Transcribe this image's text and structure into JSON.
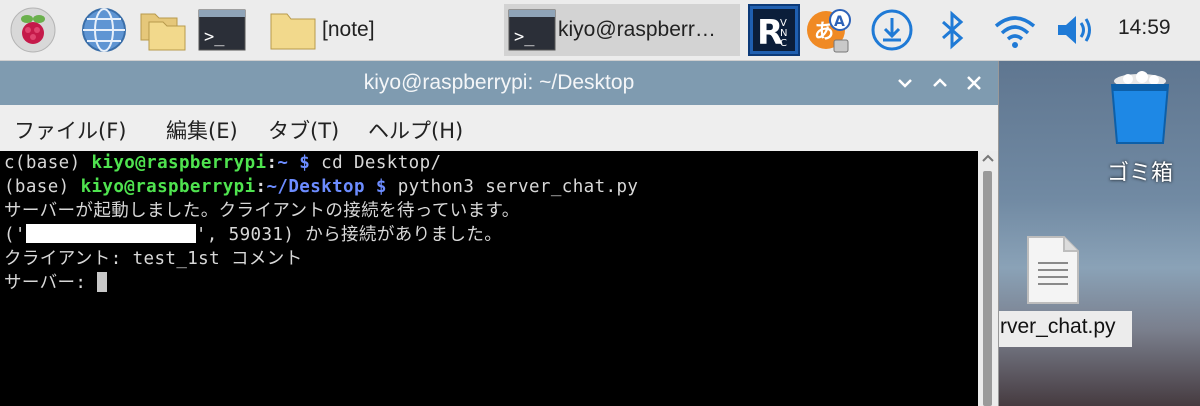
{
  "taskbar": {
    "tasks": [
      {
        "label": "[note]"
      },
      {
        "label": "kiyo@raspberr…"
      }
    ],
    "clock": "14:59"
  },
  "desktop": {
    "trash_label": "ゴミ箱",
    "file_label": "rver_chat.py"
  },
  "window": {
    "title": "kiyo@raspberrypi: ~/Desktop",
    "menu": [
      "ファイル(F)",
      "編集(E)",
      "タブ(T)",
      "ヘルプ(H)"
    ]
  },
  "terminal": {
    "line1": {
      "prefix": "c(base) ",
      "user": "kiyo@raspberrypi",
      "sep": ":",
      "path": "~",
      "prompt": " $ ",
      "cmd": "cd Desktop/"
    },
    "line2": {
      "prefix": "(base) ",
      "user": "kiyo@raspberrypi",
      "sep": ":",
      "path": "~/Desktop",
      "prompt": " $ ",
      "cmd": "python3 server_chat.py"
    },
    "line3": "サーバーが起動しました。クライアントの接続を待っています。",
    "line4": {
      "pre": "('",
      "post": "', 59031) から接続がありました。"
    },
    "line5": "クライアント: test_1st コメント",
    "line6": "サーバー: "
  },
  "colors": {
    "titlebar": "#7f9bb0",
    "terminal_bg": "#000000",
    "prompt_user": "#4fe34f",
    "prompt_path": "#6c8cff"
  }
}
